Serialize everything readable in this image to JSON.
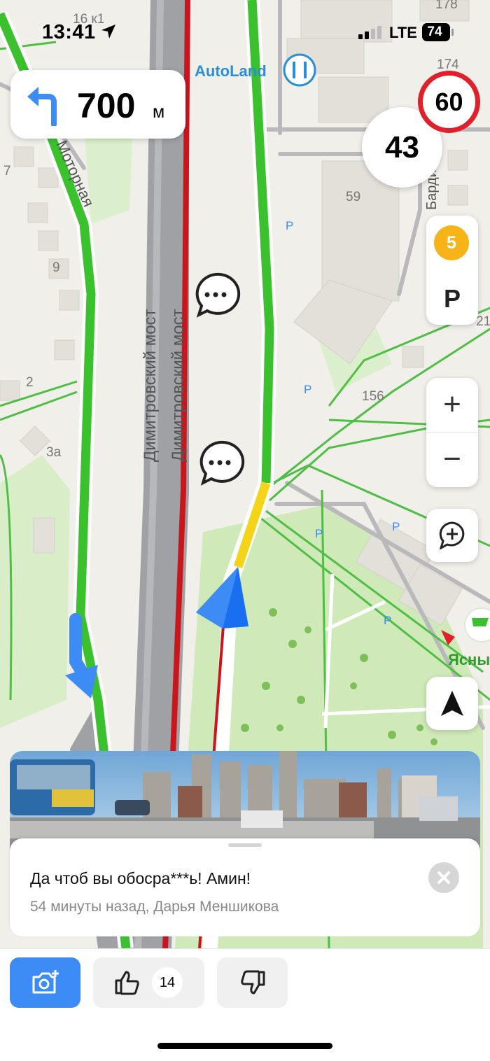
{
  "status_bar": {
    "time": "13:41",
    "network": "LTE",
    "battery": "74"
  },
  "navigation": {
    "next_turn_distance": "700",
    "next_turn_unit": "м",
    "turn_direction": "left",
    "speed_limit": "60",
    "current_speed": "43"
  },
  "map": {
    "poi_autoland": "AutoLand",
    "street_motornaya": "Моторная",
    "bridge_label_1": "Димитровский мост",
    "bridge_label_2": "Димитровский мост",
    "street_right": "Бардина",
    "poi_yasny": "Ясны",
    "building_numbers": [
      "16 к1",
      "178",
      "174",
      "59",
      "7",
      "9",
      "2",
      "3а",
      "156",
      "21"
    ],
    "parking_marker": "P"
  },
  "side_controls": {
    "events_count": "5",
    "parking_label": "P",
    "zoom_in": "+",
    "zoom_out": "−"
  },
  "event_card": {
    "comment": "Да чтоб вы обосра***ь! Амин!",
    "meta": "54 минуты назад, Дарья Меншикова"
  },
  "actions": {
    "likes": "14"
  },
  "colors": {
    "accent_blue": "#3d8cf6",
    "traffic_green": "#3cc12e",
    "traffic_yellow": "#f3d419",
    "traffic_red": "#c9151c",
    "speed_limit_red": "#e0202a",
    "events_badge": "#f6b418"
  }
}
